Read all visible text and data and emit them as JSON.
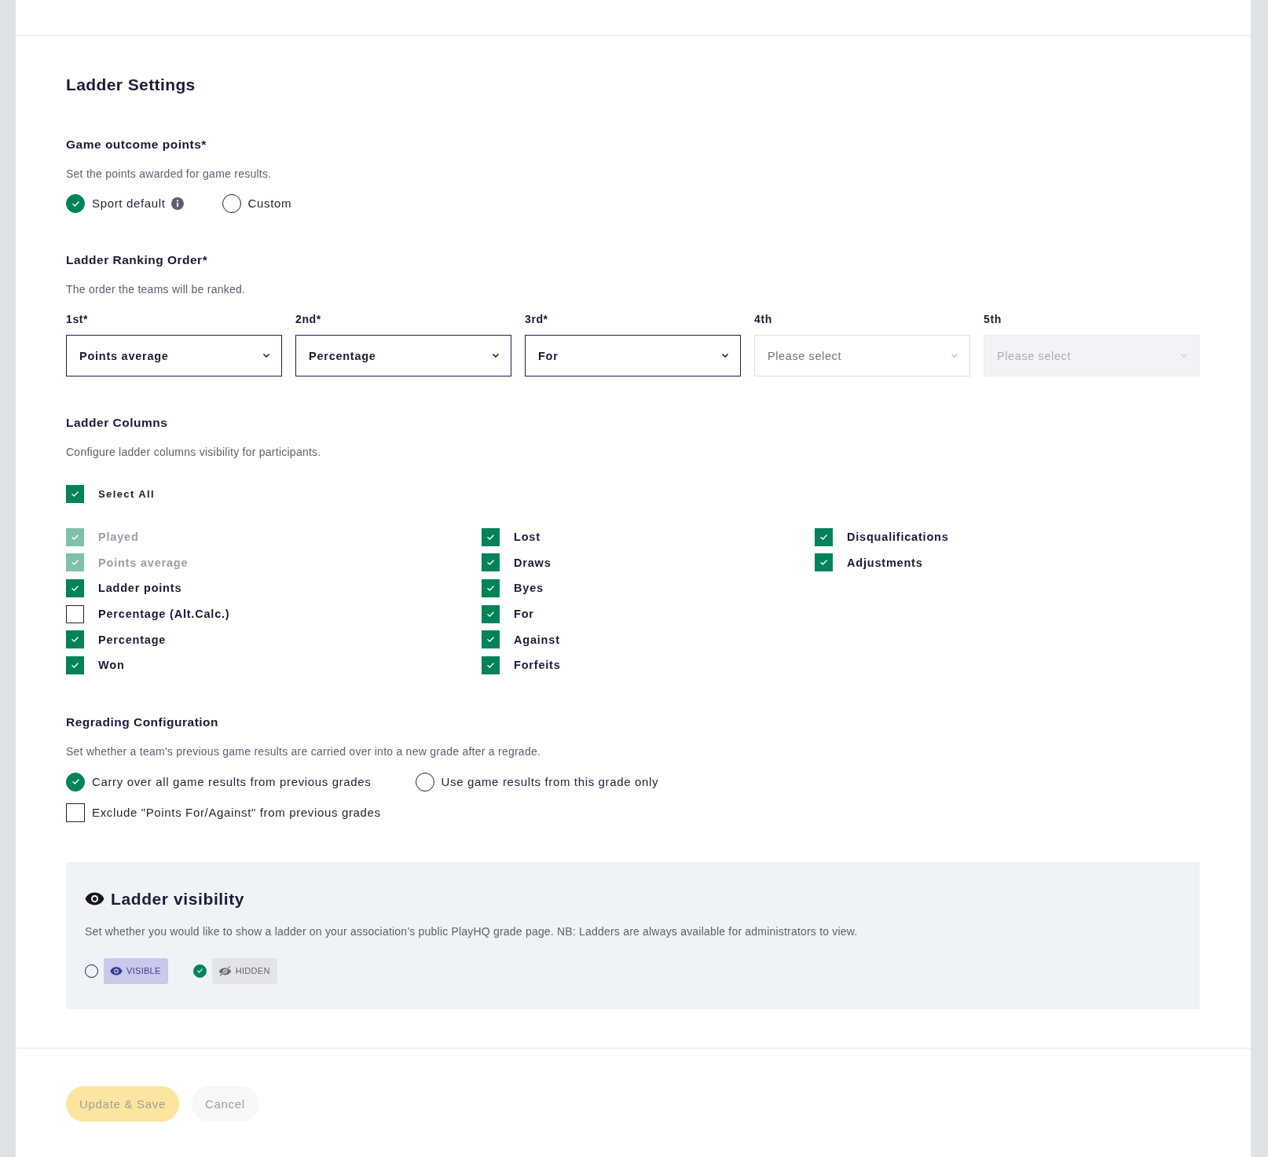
{
  "page": {
    "title": "Ladder Settings"
  },
  "game_outcome_points": {
    "label": "Game outcome points*",
    "description": "Set the points awarded for game results.",
    "options": [
      {
        "label": "Sport default",
        "selected": true,
        "info": true
      },
      {
        "label": "Custom",
        "selected": false,
        "info": false
      }
    ]
  },
  "ranking_order": {
    "label": "Ladder Ranking Order*",
    "description": "The order the teams will be ranked.",
    "slots": [
      {
        "label": "1st*",
        "value": "Points average",
        "disabled": false
      },
      {
        "label": "2nd*",
        "value": "Percentage",
        "disabled": false
      },
      {
        "label": "3rd*",
        "value": "For",
        "disabled": false
      },
      {
        "label": "4th",
        "placeholder": "Please select",
        "disabled": false
      },
      {
        "label": "5th",
        "placeholder": "Please select",
        "disabled": true
      }
    ]
  },
  "ladder_columns": {
    "label": "Ladder Columns",
    "description": "Configure ladder columns visibility for participants.",
    "select_all": {
      "label": "Select All",
      "checked": true
    },
    "checkbox_columns": [
      {
        "items": [
          {
            "label": "Played",
            "checked": true,
            "disabled": true
          },
          {
            "label": "Points average",
            "checked": true,
            "disabled": true
          },
          {
            "label": "Ladder points",
            "checked": true,
            "disabled": false
          },
          {
            "label": "Percentage (Alt.Calc.)",
            "checked": false,
            "disabled": false
          },
          {
            "label": "Percentage",
            "checked": true,
            "disabled": false
          },
          {
            "label": "Won",
            "checked": true,
            "disabled": false
          }
        ]
      },
      {
        "items": [
          {
            "label": "Lost",
            "checked": true,
            "disabled": false
          },
          {
            "label": "Draws",
            "checked": true,
            "disabled": false
          },
          {
            "label": "Byes",
            "checked": true,
            "disabled": false
          },
          {
            "label": "For",
            "checked": true,
            "disabled": false
          },
          {
            "label": "Against",
            "checked": true,
            "disabled": false
          },
          {
            "label": "Forfeits",
            "checked": true,
            "disabled": false
          }
        ]
      },
      {
        "items": [
          {
            "label": "Disqualifications",
            "checked": true,
            "disabled": false
          },
          {
            "label": "Adjustments",
            "checked": true,
            "disabled": false
          }
        ]
      }
    ]
  },
  "regrading_configuration": {
    "label": "Regrading Configuration",
    "description": "Set whether a team's previous game results are carried over into a new grade after a regrade.",
    "options": [
      {
        "label": "Carry over all game results from previous grades",
        "selected": true
      },
      {
        "label": "Use game results from this grade only",
        "selected": false
      }
    ],
    "exclude_option": {
      "label": "Exclude \"Points For/Against\" from previous grades",
      "checked": false
    }
  },
  "ladder_visibility": {
    "title": "Ladder visibility",
    "description": "Set whether you would like to show a ladder on your association’s public PlayHQ grade page. NB: Ladders are always available for administrators to view.",
    "options": [
      {
        "label": "VISIBLE",
        "kind": "visible",
        "selected": false
      },
      {
        "label": "HIDDEN",
        "kind": "hidden",
        "selected": true
      }
    ]
  },
  "actions": [
    {
      "label": "Update & Save",
      "kind": "primary"
    },
    {
      "label": "Cancel",
      "kind": "secondary"
    }
  ]
}
